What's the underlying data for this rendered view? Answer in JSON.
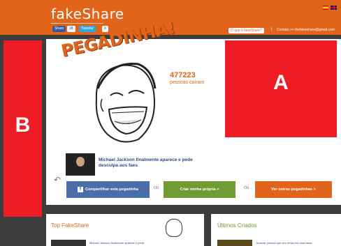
{
  "header": {
    "logo": "fakeShare",
    "share_buttons": [
      "Share",
      "18",
      "Tweetar",
      "0"
    ],
    "what_is": "O que é fakeShare?",
    "separator": "|",
    "contact": "Contato >> thefakeshare@gmail.com"
  },
  "meme": {
    "title": "PEGADINHA!",
    "counter": "477223",
    "counter_label": "pessoas caíram",
    "caption": "Michael Jackson finalmente aparece e pede desculpa aos faes"
  },
  "ads": {
    "a": "A",
    "b": "B"
  },
  "actions": {
    "share": "Compartilhar esta pegadinha",
    "or": "OU",
    "create": "Criar minha própria >",
    "more": "Ver outras pegadinhas >"
  },
  "panels": {
    "top_title": "Top FakeShare",
    "latest_title": "Últimos Criados",
    "top_item": "Michael Jackson finalmente aparece e pede",
    "latest_item": "Mostrar pessoa que seu irmão fez uma farsa"
  },
  "colors": {
    "brand": "#e2641b",
    "ad": "#ee1c24",
    "facebook": "#4a6ea8",
    "green": "#6f9a34"
  }
}
